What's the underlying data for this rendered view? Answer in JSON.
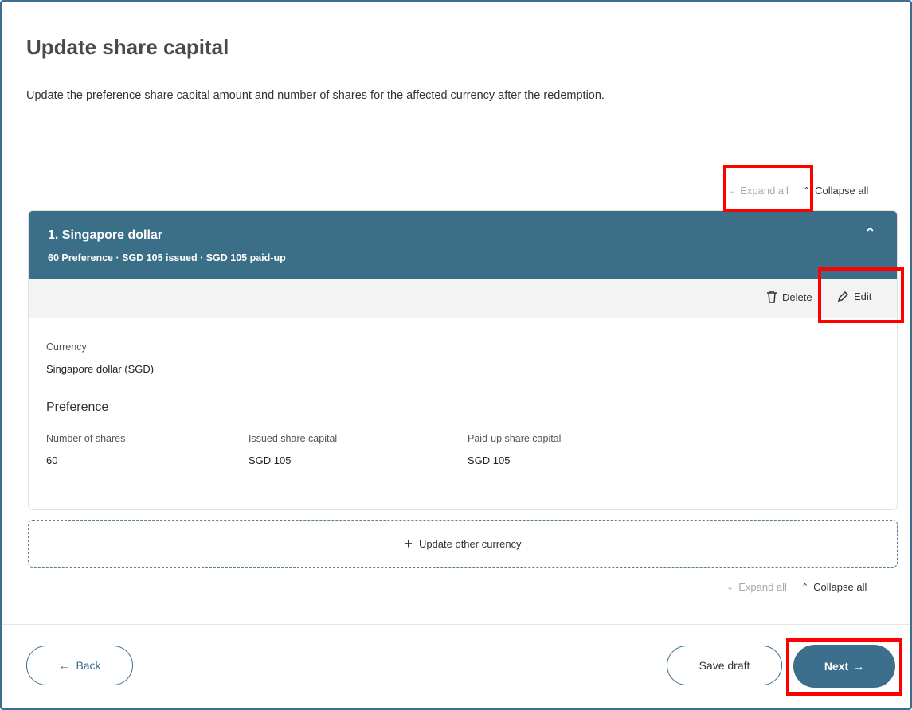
{
  "page": {
    "title": "Update share capital",
    "description": "Update the preference share capital amount and number of shares for the affected currency after the redemption."
  },
  "toggles": {
    "expand_all": "Expand all",
    "collapse_all": "Collapse all"
  },
  "currency_card": {
    "title": "1. Singapore dollar",
    "summary": "60 Preference  ·  SGD 105 issued  ·  SGD 105 paid-up",
    "actions": {
      "delete_label": "Delete",
      "edit_label": "Edit"
    },
    "currency_label": "Currency",
    "currency_value": "Singapore dollar (SGD)",
    "section_title": "Preference",
    "fields": [
      {
        "label": "Number of shares",
        "value": "60"
      },
      {
        "label": "Issued share capital",
        "value": "SGD 105"
      },
      {
        "label": "Paid-up share capital",
        "value": "SGD 105"
      }
    ]
  },
  "add_currency": {
    "label": "Update other currency"
  },
  "footer": {
    "back_label": "Back",
    "save_draft_label": "Save draft",
    "next_label": "Next"
  },
  "colors": {
    "accent": "#3b6f8c",
    "card_header": "#3a6f87",
    "highlight": "#ff0000"
  },
  "icons": [
    "chevron-down-icon",
    "chevron-up-icon",
    "trash-icon",
    "pencil-icon",
    "plus-icon",
    "arrow-left-icon",
    "arrow-right-icon"
  ]
}
